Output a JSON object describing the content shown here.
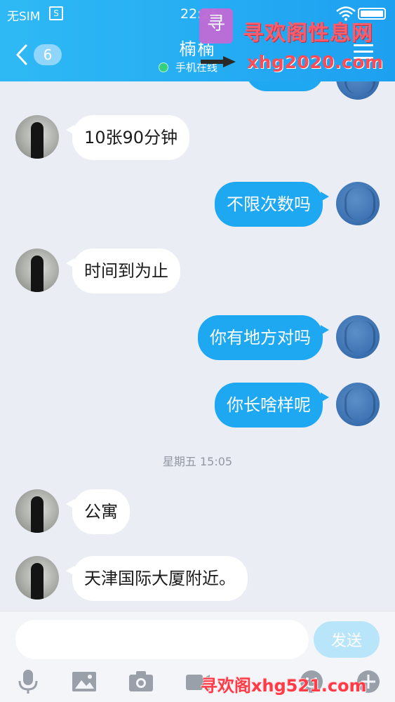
{
  "status_bar": {
    "carrier": "无SIM",
    "sim_icon_glyph": "S",
    "time": "22:25"
  },
  "header": {
    "contact_name": "楠楠",
    "contact_status": "手机在线",
    "unread_count": "6"
  },
  "watermark": {
    "title": "寻欢阁性息网",
    "url": "xhg2020.com",
    "bottom": "寻欢阁xhg521.com"
  },
  "messages": [
    {
      "dir": "out",
      "text": ""
    },
    {
      "dir": "in",
      "text": "10张90分钟"
    },
    {
      "dir": "out",
      "text": "不限次数吗"
    },
    {
      "dir": "in",
      "text": "时间到为止"
    },
    {
      "dir": "out",
      "text": "你有地方对吗"
    },
    {
      "dir": "out",
      "text": "你长啥样呢"
    },
    {
      "dir": "in",
      "text": "公寓"
    },
    {
      "dir": "in",
      "text": "天津国际大厦附近。"
    }
  ],
  "timestamp": "星期五 15:05",
  "input": {
    "placeholder": "",
    "send_label": "发送"
  },
  "toolbar": [
    "mic-icon",
    "image-icon",
    "camera-icon",
    "video-icon",
    "emoji-icon",
    "plus-icon"
  ]
}
